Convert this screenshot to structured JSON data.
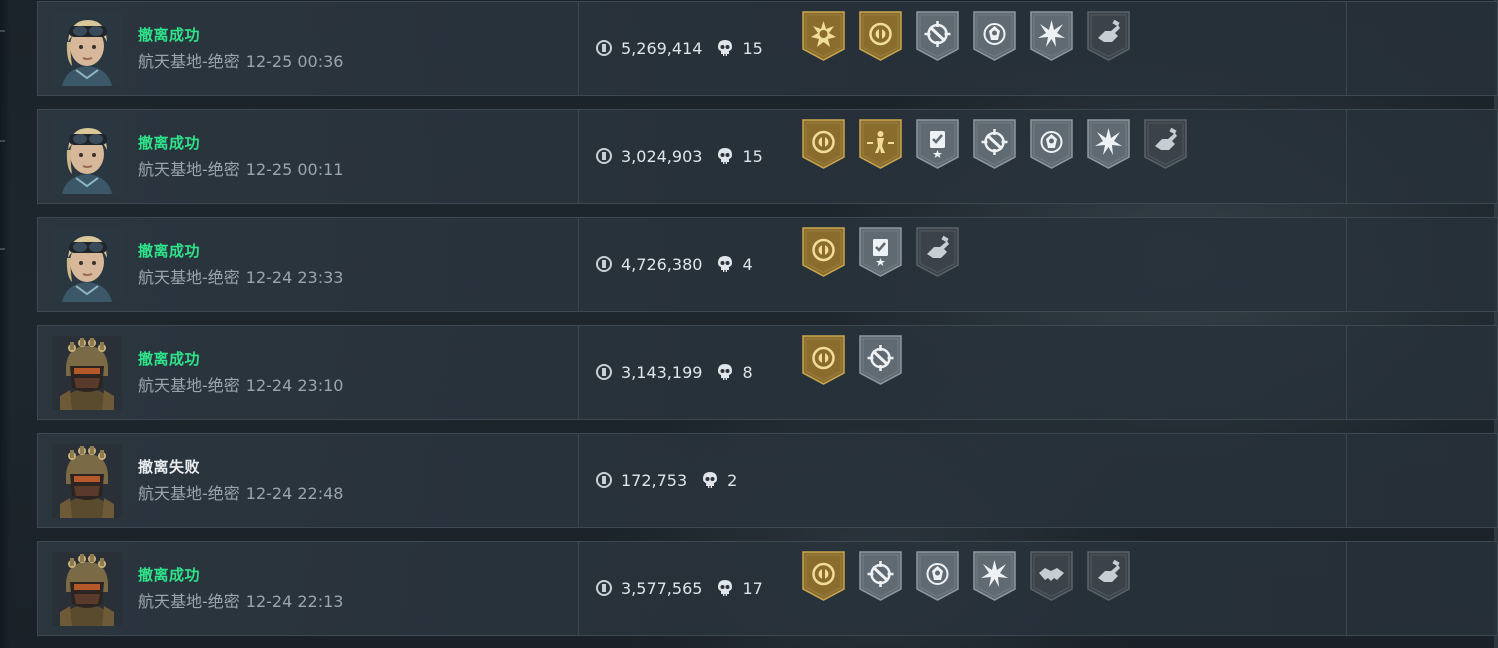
{
  "matches": [
    {
      "status": "撤离成功",
      "status_kind": "success",
      "map": "航天基地-绝密",
      "time": "12-25 00:36",
      "value": "5,269,414",
      "kills": "15",
      "operator": "blonde-goggles-operator",
      "badges": [
        {
          "name": "burst-medal-icon",
          "tier": "gold"
        },
        {
          "name": "coin-medal-icon",
          "tier": "gold"
        },
        {
          "name": "crosshair-medal-icon",
          "tier": "silver"
        },
        {
          "name": "emblem-medal-icon",
          "tier": "silver"
        },
        {
          "name": "star-burst-medal-icon",
          "tier": "silver"
        },
        {
          "name": "grab-medal-icon",
          "tier": "dark"
        }
      ]
    },
    {
      "status": "撤离成功",
      "status_kind": "success",
      "map": "航天基地-绝密",
      "time": "12-25 00:11",
      "value": "3,024,903",
      "kills": "15",
      "operator": "blonde-goggles-operator",
      "badges": [
        {
          "name": "coin-medal-icon",
          "tier": "gold"
        },
        {
          "name": "figure-medal-icon",
          "tier": "gold"
        },
        {
          "name": "clipboard-medal-icon",
          "tier": "silver"
        },
        {
          "name": "crosshair-medal-icon",
          "tier": "silver"
        },
        {
          "name": "emblem-medal-icon",
          "tier": "silver"
        },
        {
          "name": "star-burst-medal-icon",
          "tier": "silver"
        },
        {
          "name": "grab-medal-icon",
          "tier": "dark"
        }
      ]
    },
    {
      "status": "撤离成功",
      "status_kind": "success",
      "map": "航天基地-绝密",
      "time": "12-24 23:33",
      "value": "4,726,380",
      "kills": "4",
      "operator": "blonde-goggles-operator",
      "badges": [
        {
          "name": "coin-medal-icon",
          "tier": "gold"
        },
        {
          "name": "clipboard-medal-icon",
          "tier": "silver"
        },
        {
          "name": "grab-medal-icon",
          "tier": "dark"
        }
      ]
    },
    {
      "status": "撤离成功",
      "status_kind": "success",
      "map": "航天基地-绝密",
      "time": "12-24 23:10",
      "value": "3,143,199",
      "kills": "8",
      "operator": "armored-helmet-operator",
      "badges": [
        {
          "name": "coin-medal-icon",
          "tier": "gold"
        },
        {
          "name": "crosshair-medal-icon",
          "tier": "silver"
        }
      ]
    },
    {
      "status": "撤离失败",
      "status_kind": "fail",
      "map": "航天基地-绝密",
      "time": "12-24 22:48",
      "value": "172,753",
      "kills": "2",
      "operator": "armored-helmet-operator",
      "badges": []
    },
    {
      "status": "撤离成功",
      "status_kind": "success",
      "map": "航天基地-绝密",
      "time": "12-24 22:13",
      "value": "3,577,565",
      "kills": "17",
      "operator": "armored-helmet-operator",
      "badges": [
        {
          "name": "coin-medal-icon",
          "tier": "gold"
        },
        {
          "name": "crosshair-medal-icon",
          "tier": "silver"
        },
        {
          "name": "emblem-medal-icon",
          "tier": "silver"
        },
        {
          "name": "star-burst-medal-icon",
          "tier": "silver"
        },
        {
          "name": "handshake-medal-icon",
          "tier": "dark"
        },
        {
          "name": "grab-medal-icon",
          "tier": "dark"
        }
      ]
    }
  ],
  "colors": {
    "success": "#2ee38a",
    "fail": "#e9edf0",
    "gold_fill": "#8a6d2c",
    "silver_fill": "#5f6a72",
    "dark_fill": "#3b4249"
  }
}
